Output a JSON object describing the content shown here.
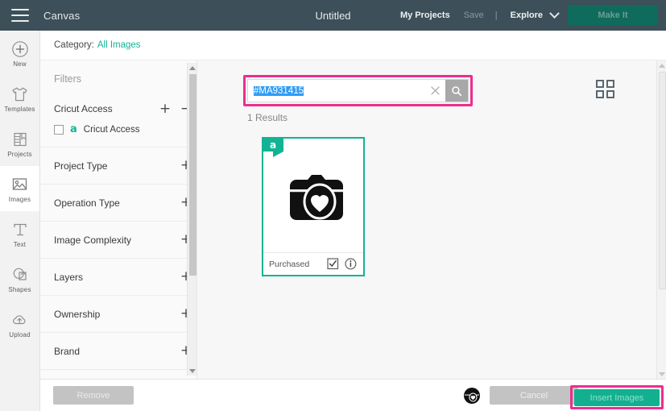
{
  "topbar": {
    "menu_icon": "hamburger-icon",
    "canvas_label": "Canvas",
    "project_title": "Untitled",
    "my_projects": "My Projects",
    "save": "Save",
    "separator": "|",
    "explore": "Explore",
    "make_it": "Make It"
  },
  "rail": {
    "items": [
      {
        "label": "New",
        "icon": "plus-circle-icon",
        "active": false
      },
      {
        "label": "Templates",
        "icon": "tshirt-icon",
        "active": false
      },
      {
        "label": "Projects",
        "icon": "book-icon",
        "active": false
      },
      {
        "label": "Images",
        "icon": "image-icon",
        "active": true
      },
      {
        "label": "Text",
        "icon": "text-t-icon",
        "active": false
      },
      {
        "label": "Shapes",
        "icon": "shapes-icon",
        "active": false
      },
      {
        "label": "Upload",
        "icon": "upload-cloud-icon",
        "active": false
      }
    ]
  },
  "category_bar": {
    "label": "Category:",
    "value": "All Images"
  },
  "filters": {
    "title": "Filters",
    "groups": [
      {
        "label": "Cricut Access",
        "expanded": true,
        "plus": "+",
        "minus": "−"
      },
      {
        "label": "Project Type",
        "expanded": false,
        "plus": "+"
      },
      {
        "label": "Operation Type",
        "expanded": false,
        "plus": "+"
      },
      {
        "label": "Image Complexity",
        "expanded": false,
        "plus": "+"
      },
      {
        "label": "Layers",
        "expanded": false,
        "plus": "+"
      },
      {
        "label": "Ownership",
        "expanded": false,
        "plus": "+"
      },
      {
        "label": "Brand",
        "expanded": false,
        "plus": "+"
      }
    ],
    "cricut_access_option": {
      "label": "Cricut Access",
      "checked": false,
      "badge_icon": "cricut-a-logo"
    }
  },
  "search": {
    "value": "#MA931415",
    "placeholder": "Search",
    "selected": true,
    "clear_icon": "close-x-icon",
    "search_icon": "magnifier-icon"
  },
  "results": {
    "count_label": "1 Results",
    "grid_toggle_icon": "grid-view-icon",
    "cards": [
      {
        "name": "camera-heart-image",
        "status": "Purchased",
        "badge": "a",
        "badge_title": "Cricut Access",
        "selected": true,
        "select_icon": "checkbox-checked-icon",
        "info_icon": "info-circle-icon"
      }
    ]
  },
  "bottombar": {
    "remove": "Remove",
    "cancel": "Cancel",
    "insert": "Insert Images",
    "selected_thumb_icon": "camera-heart-thumb"
  },
  "colors": {
    "accent_green": "#12b394",
    "highlight_magenta": "#ec2e8f",
    "topbar": "#3d4f58",
    "selection_blue": "#2f9cf4"
  }
}
